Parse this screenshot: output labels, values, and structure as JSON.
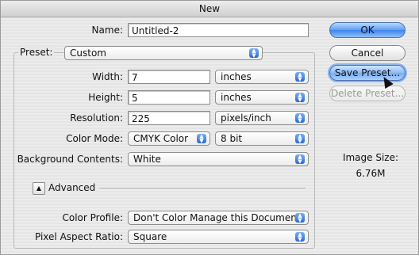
{
  "window": {
    "title": "New"
  },
  "form": {
    "name_label": "Name:",
    "name_value": "Untitled-2",
    "preset_label": "Preset:",
    "preset_value": "Custom",
    "width_label": "Width:",
    "width_value": "7",
    "width_unit": "inches",
    "height_label": "Height:",
    "height_value": "5",
    "height_unit": "inches",
    "resolution_label": "Resolution:",
    "resolution_value": "225",
    "resolution_unit": "pixels/inch",
    "color_mode_label": "Color Mode:",
    "color_mode_value": "CMYK Color",
    "bit_depth_value": "8 bit",
    "background_label": "Background Contents:",
    "background_value": "White",
    "advanced_label": "Advanced",
    "color_profile_label": "Color Profile:",
    "color_profile_value": "Don't Color Manage this Document",
    "pixel_aspect_label": "Pixel Aspect Ratio:",
    "pixel_aspect_value": "Square"
  },
  "buttons": {
    "ok": "OK",
    "cancel": "Cancel",
    "save_preset": "Save Preset...",
    "delete_preset": "Delete Preset..."
  },
  "info": {
    "image_size_label": "Image Size:",
    "image_size_value": "6.76M"
  }
}
